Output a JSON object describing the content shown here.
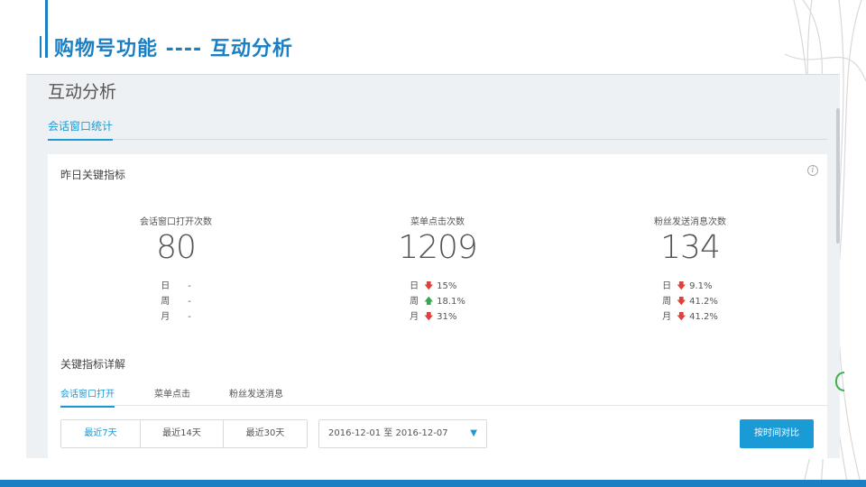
{
  "slide": {
    "title": "购物号功能 ----  互动分析"
  },
  "page": {
    "title": "互动分析",
    "tab_active": "会话窗口统计"
  },
  "card": {
    "title": "昨日关键指标",
    "info_icon": "info-icon",
    "metrics": [
      {
        "label": "会话窗口打开次数",
        "value": "80",
        "rows": [
          {
            "period": "日",
            "direction": "none",
            "change": "-"
          },
          {
            "period": "周",
            "direction": "none",
            "change": "-"
          },
          {
            "period": "月",
            "direction": "none",
            "change": "-"
          }
        ]
      },
      {
        "label": "菜单点击次数",
        "value": "1209",
        "rows": [
          {
            "period": "日",
            "direction": "down",
            "change": "15%"
          },
          {
            "period": "周",
            "direction": "up",
            "change": "18.1%"
          },
          {
            "period": "月",
            "direction": "down",
            "change": "31%"
          }
        ]
      },
      {
        "label": "粉丝发送消息次数",
        "value": "134",
        "rows": [
          {
            "period": "日",
            "direction": "down",
            "change": "9.1%"
          },
          {
            "period": "周",
            "direction": "down",
            "change": "41.2%"
          },
          {
            "period": "月",
            "direction": "down",
            "change": "41.2%"
          }
        ]
      }
    ]
  },
  "detail": {
    "title": "关键指标详解",
    "subtabs": [
      "会话窗口打开",
      "菜单点击",
      "粉丝发送消息"
    ],
    "active_subtab": 0,
    "range_buttons": [
      "最近7天",
      "最近14天",
      "最近30天"
    ],
    "active_range": 0,
    "date_range": "2016-12-01 至 2016-12-07",
    "compare_button": "按时间对比"
  },
  "colors": {
    "accent": "#1b9bd6",
    "slide_brand": "#1b7fc4",
    "down": "#e0403a",
    "up": "#33a94a"
  }
}
